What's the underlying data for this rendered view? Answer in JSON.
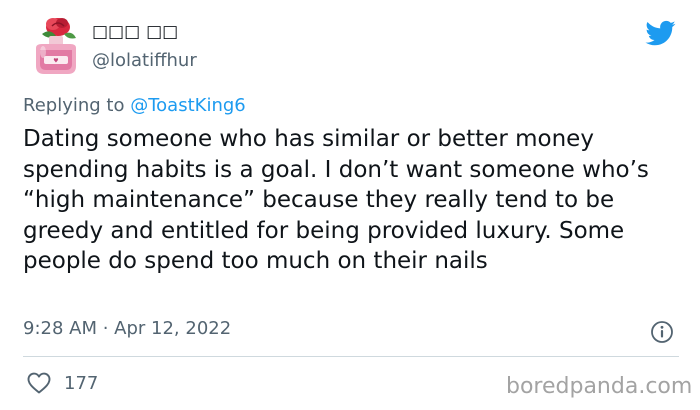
{
  "tweet": {
    "display_name": "□□□ □□",
    "handle": "@lolatiffhur",
    "replying_prefix": "Replying to",
    "replying_to": "@ToastKing6",
    "body": "Dating someone who has similar or better money spending habits is a goal. I don’t want someone who’s “high maintenance” because they really tend to be greedy and entitled for being provided luxury. Some people do spend too much on their nails",
    "timestamp": "9:28 AM · Apr 12, 2022",
    "likes": "177"
  },
  "watermark": "boredpanda.com",
  "icons": {
    "avatar": "perfume-bottle-avatar",
    "platform": "twitter-bird-icon",
    "info": "info-icon",
    "like": "heart-icon"
  },
  "colors": {
    "text": "#0f1419",
    "secondary": "#536471",
    "accent": "#1d9bf0",
    "divider": "#cfd9de",
    "watermark": "#a3a3a3"
  }
}
